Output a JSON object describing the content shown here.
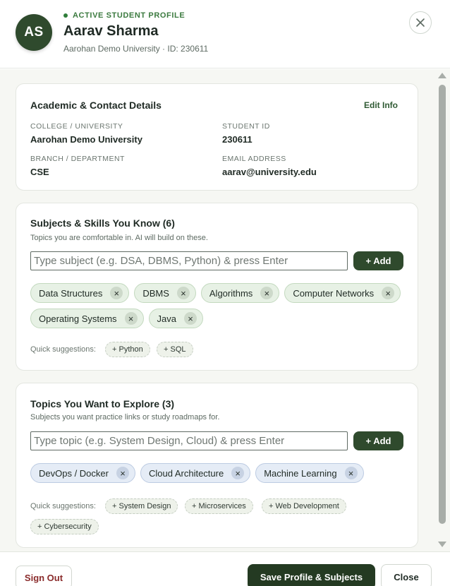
{
  "header": {
    "avatar_initials": "AS",
    "status": "ACTIVE STUDENT PROFILE",
    "name": "Aarav Sharma",
    "subtitle": "Aarohan Demo University · ID: 230611"
  },
  "academic": {
    "title": "Academic & Contact Details",
    "edit_label": "Edit Info",
    "college_label": "COLLEGE / UNIVERSITY",
    "college_value": "Aarohan Demo University",
    "student_id_label": "STUDENT ID",
    "student_id_value": "230611",
    "branch_label": "BRANCH / DEPARTMENT",
    "branch_value": "CSE",
    "email_label": "EMAIL ADDRESS",
    "email_value": "aarav@university.edu"
  },
  "skills": {
    "title": "Subjects & Skills You Know (6)",
    "description": "Topics you are comfortable in. AI will build on these.",
    "input_placeholder": "Type subject (e.g. DSA, DBMS, Python) & press Enter",
    "add_label": "+ Add",
    "chips": [
      "Data Structures",
      "DBMS",
      "Algorithms",
      "Computer Networks",
      "Operating Systems",
      "Java"
    ],
    "suggestions_label": "Quick suggestions:",
    "suggestions": [
      "+ Python",
      "+ SQL"
    ]
  },
  "explore": {
    "title": "Topics You Want to Explore (3)",
    "description": "Subjects you want practice links or study roadmaps for.",
    "input_placeholder": "Type topic (e.g. System Design, Cloud) & press Enter",
    "add_label": "+ Add",
    "chips": [
      "DevOps / Docker",
      "Cloud Architecture",
      "Machine Learning"
    ],
    "suggestions_label": "Quick suggestions:",
    "suggestions": [
      "+ System Design",
      "+ Microservices",
      "+ Web Development",
      "+ Cybersecurity"
    ]
  },
  "chip_remove_glyph": "×",
  "footer": {
    "sign_out_label": "Sign Out",
    "save_label": "Save Profile & Subjects",
    "close_label": "Close"
  },
  "colors": {
    "brand_green": "#2f4a2d",
    "skill_chip": "#e7f1e5",
    "explore_chip": "#e5ecf6",
    "danger_text": "#8a2b2b"
  }
}
